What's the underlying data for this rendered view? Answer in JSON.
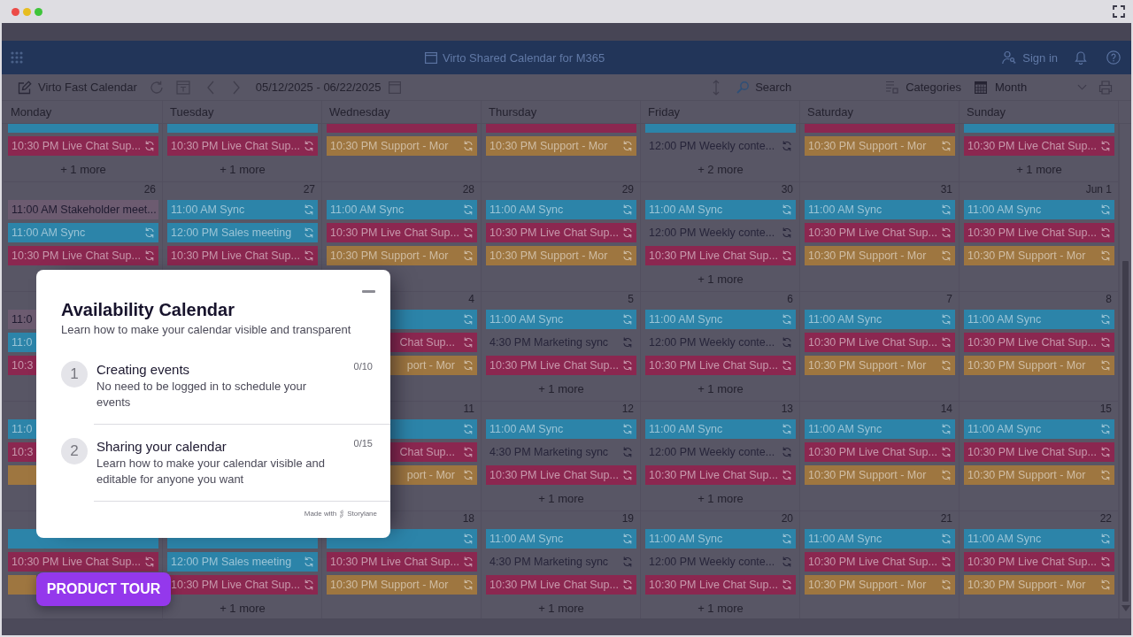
{
  "app_header": {
    "title": "Virto Shared Calendar for M365",
    "sign_in": "Sign in"
  },
  "toolbar": {
    "calendar_name": "Virto Fast Calendar",
    "date_range": "05/12/2025 - 06/22/2025",
    "search": {
      "placeholder": "Search"
    },
    "categories": "Categories",
    "view": "Month"
  },
  "calendar": {
    "weekdays": [
      "Monday",
      "Tuesday",
      "Wednesday",
      "Thursday",
      "Friday",
      "Saturday",
      "Sunday"
    ],
    "weeks": [
      {
        "monday": {
          "clipped_event": {
            "color": "#2c84a9"
          },
          "events": [
            {
              "text": "10:30 PM Live Chat Sup...",
              "color": "#8b2750",
              "recurring": true
            }
          ],
          "more": "+ 1 more"
        },
        "tuesday": {
          "clipped_event": {
            "color": "#2c84a9"
          },
          "events": [
            {
              "text": "10:30 PM Live Chat Sup...",
              "color": "#8b2750",
              "recurring": true
            }
          ],
          "more": "+ 1 more"
        },
        "wednesday": {
          "clipped_event": {
            "color": "#8b2750"
          },
          "events": [
            {
              "text": "10:30 PM Support - Mor",
              "color": "#9e7640",
              "recurring": true
            }
          ]
        },
        "thursday": {
          "clipped_event": {
            "color": "#8b2750"
          },
          "events": [
            {
              "text": "10:30 PM Support - Mor",
              "color": "#9e7640",
              "recurring": true
            }
          ]
        },
        "friday": {
          "clipped_event": {
            "color": "#2c84a9"
          },
          "events": [
            {
              "text": "12:00 PM Weekly conte...",
              "recurring": true
            }
          ],
          "more": "+ 2 more"
        },
        "saturday": {
          "clipped_event": {
            "color": "#8b2750"
          },
          "events": [
            {
              "text": "10:30 PM Support - Mor",
              "color": "#9e7640",
              "recurring": true
            }
          ]
        },
        "sunday": {
          "clipped_event": {
            "color": "#2c84a9"
          },
          "events": [
            {
              "text": "10:30 PM Live Chat Sup...",
              "color": "#8b2750",
              "recurring": true
            }
          ],
          "more": "+ 1 more"
        }
      },
      {
        "monday": {
          "date": "26",
          "events": [
            {
              "text": "11:00 AM Stakeholder meet...",
              "color": "#6c5b70",
              "recurring": false
            },
            {
              "text": "11:00 AM Sync",
              "color": "#2c84a9",
              "recurring": true
            },
            {
              "text": "10:30 PM Live Chat Sup...",
              "color": "#8b2750",
              "recurring": true
            }
          ]
        },
        "tuesday": {
          "date": "27",
          "events": [
            {
              "text": "11:00 AM Sync",
              "color": "#2c84a9",
              "recurring": true
            },
            {
              "text": "12:00 PM Sales meeting",
              "color": "#2c84a9",
              "recurring": true
            },
            {
              "text": "10:30 PM Live Chat Sup...",
              "color": "#8b2750",
              "recurring": true
            }
          ]
        },
        "wednesday": {
          "date": "28",
          "events": [
            {
              "text": "11:00 AM Sync",
              "color": "#2c84a9",
              "recurring": true
            },
            {
              "text": "10:30 PM Live Chat Sup...",
              "color": "#8b2750",
              "recurring": true
            },
            {
              "text": "10:30 PM Support - Mor",
              "color": "#9e7640",
              "recurring": true
            }
          ]
        },
        "thursday": {
          "date": "29",
          "events": [
            {
              "text": "11:00 AM Sync",
              "color": "#2c84a9",
              "recurring": true
            },
            {
              "text": "10:30 PM Live Chat Sup...",
              "color": "#8b2750",
              "recurring": true
            },
            {
              "text": "10:30 PM Support - Mor",
              "color": "#9e7640",
              "recurring": true
            }
          ]
        },
        "friday": {
          "date": "30",
          "events": [
            {
              "text": "11:00 AM Sync",
              "color": "#2c84a9",
              "recurring": true
            },
            {
              "text": "12:00 PM Weekly conte...",
              "recurring": true
            },
            {
              "text": "10:30 PM Live Chat Sup...",
              "color": "#8b2750",
              "recurring": true
            }
          ],
          "more": "+ 1 more"
        },
        "saturday": {
          "date": "31",
          "events": [
            {
              "text": "11:00 AM Sync",
              "color": "#2c84a9",
              "recurring": true
            },
            {
              "text": "10:30 PM Live Chat Sup...",
              "color": "#8b2750",
              "recurring": true
            },
            {
              "text": "10:30 PM Support - Mor",
              "color": "#9e7640",
              "recurring": true
            }
          ]
        },
        "sunday": {
          "date": "Jun 1",
          "events": [
            {
              "text": "11:00 AM Sync",
              "color": "#2c84a9",
              "recurring": true
            },
            {
              "text": "10:30 PM Live Chat Sup...",
              "color": "#8b2750",
              "recurring": true
            },
            {
              "text": "10:30 PM Support - Mor",
              "color": "#9e7640",
              "recurring": true
            }
          ]
        }
      },
      {
        "monday": {
          "events": [
            {
              "text": "11:0",
              "color": "#6c5b70"
            },
            {
              "text": "11:0",
              "color": "#2c84a9"
            },
            {
              "text": "10:3",
              "color": "#8b2750"
            }
          ]
        },
        "wednesday": {
          "date": "4",
          "events": [
            {
              "color": "#2c84a9",
              "recurring": true
            },
            {
              "text": "Chat Sup...",
              "color": "#8b2750",
              "recurring": true,
              "start_hidden": true
            },
            {
              "text": "port - Mor",
              "color": "#9e7640",
              "recurring": true,
              "start_hidden": true
            }
          ]
        },
        "thursday": {
          "date": "5",
          "events": [
            {
              "text": "11:00 AM Sync",
              "color": "#2c84a9",
              "recurring": true
            },
            {
              "text": "4:30 PM Marketing sync",
              "recurring": true
            },
            {
              "text": "10:30 PM Live Chat Sup...",
              "color": "#8b2750",
              "recurring": true
            }
          ],
          "more": "+ 1 more"
        },
        "friday": {
          "date": "6",
          "events": [
            {
              "text": "11:00 AM Sync",
              "color": "#2c84a9",
              "recurring": true
            },
            {
              "text": "12:00 PM Weekly conte...",
              "recurring": true
            },
            {
              "text": "10:30 PM Live Chat Sup...",
              "color": "#8b2750",
              "recurring": true
            }
          ],
          "more": "+ 1 more"
        },
        "saturday": {
          "date": "7",
          "events": [
            {
              "text": "11:00 AM Sync",
              "color": "#2c84a9",
              "recurring": true
            },
            {
              "text": "10:30 PM Live Chat Sup...",
              "color": "#8b2750",
              "recurring": true
            },
            {
              "text": "10:30 PM Support - Mor",
              "color": "#9e7640",
              "recurring": true
            }
          ]
        },
        "sunday": {
          "date": "8",
          "events": [
            {
              "text": "11:00 AM Sync",
              "color": "#2c84a9",
              "recurring": true
            },
            {
              "text": "10:30 PM Live Chat Sup...",
              "color": "#8b2750",
              "recurring": true
            },
            {
              "text": "10:30 PM Support - Mor",
              "color": "#9e7640",
              "recurring": true
            }
          ]
        }
      },
      {
        "monday": {
          "events": [
            {
              "text": "11:0",
              "color": "#2c84a9"
            },
            {
              "text": "10:3",
              "color": "#8b2750"
            },
            {
              "color": "#9e7640"
            }
          ]
        },
        "wednesday": {
          "date": "11",
          "events": [
            {
              "color": "#2c84a9",
              "recurring": true
            },
            {
              "text": "Chat Sup...",
              "color": "#8b2750",
              "recurring": true,
              "start_hidden": true
            },
            {
              "text": "port - Mor",
              "color": "#9e7640",
              "recurring": true,
              "start_hidden": true
            }
          ]
        },
        "thursday": {
          "date": "12",
          "events": [
            {
              "text": "11:00 AM Sync",
              "color": "#2c84a9",
              "recurring": true
            },
            {
              "text": "4:30 PM Marketing sync",
              "recurring": true
            },
            {
              "text": "10:30 PM Live Chat Sup...",
              "color": "#8b2750",
              "recurring": true
            }
          ],
          "more": "+ 1 more"
        },
        "friday": {
          "date": "13",
          "events": [
            {
              "text": "11:00 AM Sync",
              "color": "#2c84a9",
              "recurring": true
            },
            {
              "text": "12:00 PM Weekly conte...",
              "recurring": true
            },
            {
              "text": "10:30 PM Live Chat Sup...",
              "color": "#8b2750",
              "recurring": true
            }
          ],
          "more": "+ 1 more"
        },
        "saturday": {
          "date": "14",
          "events": [
            {
              "text": "11:00 AM Sync",
              "color": "#2c84a9",
              "recurring": true
            },
            {
              "text": "10:30 PM Live Chat Sup...",
              "color": "#8b2750",
              "recurring": true
            },
            {
              "text": "10:30 PM Support - Mor",
              "color": "#9e7640",
              "recurring": true
            }
          ]
        },
        "sunday": {
          "date": "15",
          "events": [
            {
              "text": "11:00 AM Sync",
              "color": "#2c84a9",
              "recurring": true
            },
            {
              "text": "10:30 PM Live Chat Sup...",
              "color": "#8b2750",
              "recurring": true
            },
            {
              "text": "10:30 PM Support - Mor",
              "color": "#9e7640",
              "recurring": true
            }
          ]
        }
      },
      {
        "monday": {
          "events": [
            {
              "color": "#2c84a9"
            },
            {
              "text": "10:30 PM Live Chat Sup...",
              "color": "#8b2750",
              "recurring": true
            },
            {
              "color": "#9e7640",
              "end_hidden": true
            }
          ]
        },
        "tuesday": {
          "events": [
            {
              "color": "#2c84a9"
            },
            {
              "text": "12:00 PM Sales meeting",
              "color": "#2c84a9",
              "recurring": true
            },
            {
              "text": "10:30 PM Live Chat Sup...",
              "color": "#8b2750",
              "recurring": true
            }
          ],
          "more": "+ 1 more"
        },
        "wednesday": {
          "date": "18",
          "events": [
            {
              "color": "#2c84a9",
              "recurring": true
            },
            {
              "text": "10:30 PM Live Chat Sup...",
              "color": "#8b2750",
              "recurring": true
            },
            {
              "text": "10:30 PM Support - Mor",
              "color": "#9e7640",
              "recurring": true
            }
          ]
        },
        "thursday": {
          "date": "19",
          "events": [
            {
              "text": "11:00 AM Sync",
              "color": "#2c84a9",
              "recurring": true
            },
            {
              "text": "4:30 PM Marketing sync",
              "recurring": true
            },
            {
              "text": "10:30 PM Live Chat Sup...",
              "color": "#8b2750",
              "recurring": true
            }
          ],
          "more": "+ 1 more"
        },
        "friday": {
          "date": "20",
          "events": [
            {
              "text": "11:00 AM Sync",
              "color": "#2c84a9",
              "recurring": true
            },
            {
              "text": "12:00 PM Weekly conte...",
              "recurring": true
            },
            {
              "text": "10:30 PM Live Chat Sup...",
              "color": "#8b2750",
              "recurring": true
            }
          ],
          "more": "+ 1 more"
        },
        "saturday": {
          "date": "21",
          "events": [
            {
              "text": "11:00 AM Sync",
              "color": "#2c84a9",
              "recurring": true
            },
            {
              "text": "10:30 PM Live Chat Sup...",
              "color": "#8b2750",
              "recurring": true
            },
            {
              "text": "10:30 PM Support - Mor",
              "color": "#9e7640",
              "recurring": true
            }
          ]
        },
        "sunday": {
          "date": "22",
          "events": [
            {
              "text": "11:00 AM Sync",
              "color": "#2c84a9",
              "recurring": true
            },
            {
              "text": "10:30 PM Live Chat Sup...",
              "color": "#8b2750",
              "recurring": true
            },
            {
              "text": "10:30 PM Support - Mor",
              "color": "#9e7640",
              "recurring": true
            }
          ]
        }
      }
    ]
  },
  "tour_panel": {
    "title": "Availability Calendar",
    "subtitle": "Learn how to make your calendar visible and transparent",
    "steps": [
      {
        "number": "1",
        "title": "Creating events",
        "description": "No need to be logged in to schedule your events",
        "progress": "0/10"
      },
      {
        "number": "2",
        "title": "Sharing your calendar",
        "description": "Learn how to make your calendar visible and editable for anyone you want",
        "progress": "0/15"
      }
    ],
    "footer": {
      "made_with": "Made with",
      "brand": "Storylane"
    }
  },
  "tour_button": {
    "label": "PRODUCT TOUR"
  }
}
